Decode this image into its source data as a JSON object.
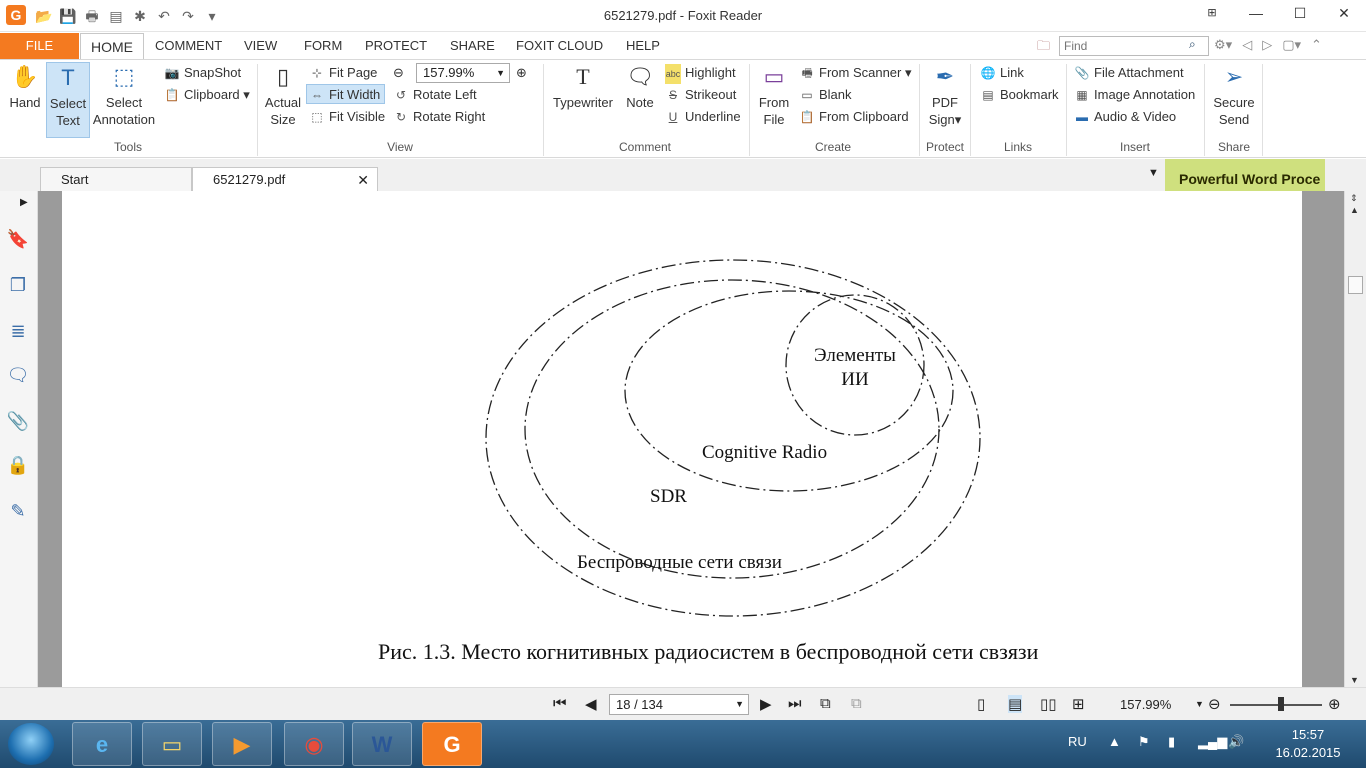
{
  "window": {
    "title": "6521279.pdf - Foxit Reader",
    "minimize_label": "—",
    "maximize_label": "☐",
    "close_label": "✕"
  },
  "ribbon_tabs": {
    "file": "FILE",
    "home": "HOME",
    "comment": "COMMENT",
    "view": "VIEW",
    "form": "FORM",
    "protect": "PROTECT",
    "share": "SHARE",
    "foxit_cloud": "FOXIT CLOUD",
    "help": "HELP"
  },
  "search": {
    "placeholder": "Find"
  },
  "tools": {
    "hand": "Hand",
    "select_text": [
      "Select",
      "Text"
    ],
    "select_annotation": [
      "Select",
      "Annotation"
    ],
    "snapshot": "SnapShot",
    "clipboard": "Clipboard",
    "group_label": "Tools"
  },
  "view": {
    "actual_size": [
      "Actual",
      "Size"
    ],
    "fit_page": "Fit Page",
    "fit_width": "Fit Width",
    "fit_visible": "Fit Visible",
    "zoom_value": "157.99%",
    "rotate_left": "Rotate Left",
    "rotate_right": "Rotate Right",
    "group_label": "View"
  },
  "comment": {
    "typewriter": "Typewriter",
    "note": "Note",
    "highlight": "Highlight",
    "strikeout": "Strikeout",
    "underline": "Underline",
    "group_label": "Comment"
  },
  "create": {
    "from_file": [
      "From",
      "File"
    ],
    "from_scanner": "From Scanner",
    "blank": "Blank",
    "from_clipboard": "From Clipboard",
    "group_label": "Create"
  },
  "protect": {
    "pdf_sign": [
      "PDF",
      "Sign"
    ],
    "group_label": "Protect"
  },
  "links": {
    "link": "Link",
    "bookmark": "Bookmark",
    "group_label": "Links"
  },
  "insert": {
    "file_attachment": "File Attachment",
    "image_annotation": "Image Annotation",
    "audio_video": "Audio & Video",
    "group_label": "Insert"
  },
  "share": {
    "secure_send": [
      "Secure",
      "Send"
    ],
    "group_label": "Share"
  },
  "doc_tabs": {
    "start": "Start",
    "current": "6521279.pdf",
    "promo": "Powerful Word Proce"
  },
  "figure": {
    "label_ai": [
      "Элементы",
      "ИИ"
    ],
    "label_cognitive": "Cognitive Radio",
    "label_sdr": "SDR",
    "label_wireless": "Беспроводные сети связи",
    "caption": "Рис. 1.3. Место когнитивных радиосистем в беспроводной сети свзязи"
  },
  "statusbar": {
    "page_indicator": "18 / 134",
    "zoom": "157.99%"
  },
  "taskbar": {
    "language": "RU",
    "time": "15:57",
    "date": "16.02.2015"
  }
}
